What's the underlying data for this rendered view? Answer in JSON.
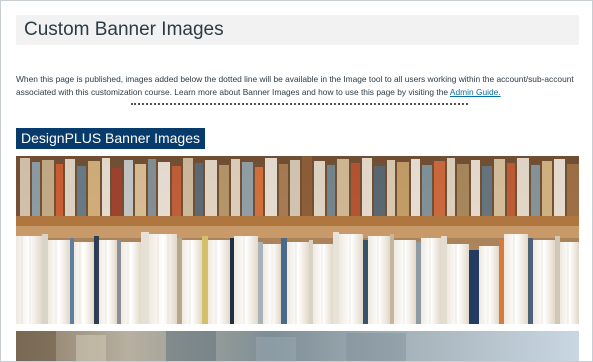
{
  "page": {
    "title": "Custom Banner Images",
    "intro_text": "When this page is published, images added below the dotted line will be available in the Image tool to all users working within the account/sub-account associated with this customization course. Learn more about Banner Images and how to use this page by visiting the ",
    "intro_link": "Admin Guide."
  },
  "section": {
    "heading": "DesignPLUS Banner Images"
  },
  "banners": [
    {
      "subject": "library bookshelves with books"
    },
    {
      "subject": "partially visible library image"
    }
  ]
}
